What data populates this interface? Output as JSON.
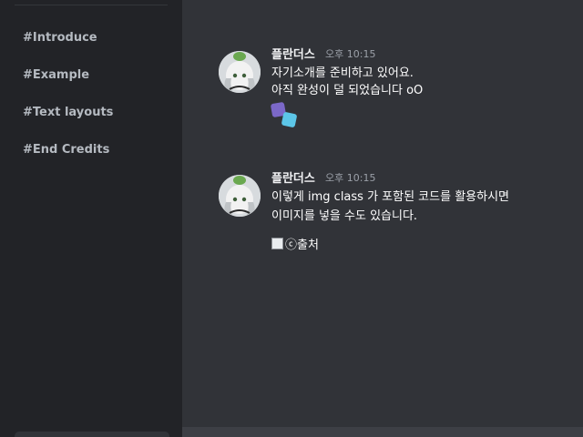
{
  "sidebar": {
    "channels": [
      {
        "label": "#Introduce"
      },
      {
        "label": "#Example"
      },
      {
        "label": "#Text layouts"
      },
      {
        "label": "#End Credits"
      }
    ]
  },
  "messages": [
    {
      "author": "플란더스",
      "time": "오후 10:15",
      "lines": [
        "자기소개를 준비하고 있어요.",
        "아직 완성이 덜 되었습니다 oO"
      ],
      "emoji": "dice"
    },
    {
      "author": "플란더스",
      "time": "오후 10:15",
      "lines": [
        "이렇게 img class 가 포함된 코드를 활용하시면",
        "이미지를 넣을 수도 있습니다."
      ],
      "image_alt": "ⓒ출처"
    }
  ],
  "colors": {
    "sidebar_bg": "#222327",
    "main_bg": "#313338",
    "channel_text": "#b5bac1",
    "author_text": "#f2f3f5",
    "time_text": "#9ba0a8",
    "dice_purple": "#7b68c8",
    "dice_cyan": "#5cc6e8"
  }
}
